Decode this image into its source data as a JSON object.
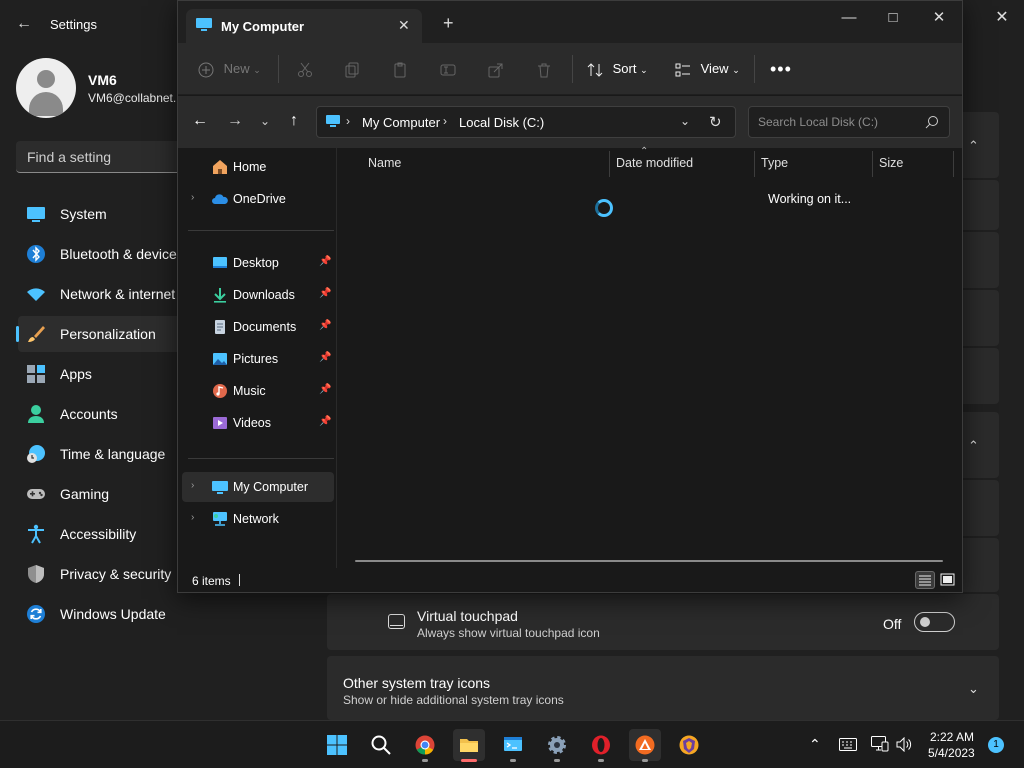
{
  "settings": {
    "title": "Settings",
    "user": {
      "name": "VM6",
      "email": "VM6@collabnet."
    },
    "search_placeholder": "Find a setting",
    "nav": [
      {
        "label": "System",
        "icon": "system-icon"
      },
      {
        "label": "Bluetooth & devices",
        "icon": "bluetooth-icon"
      },
      {
        "label": "Network & internet",
        "icon": "network-icon"
      },
      {
        "label": "Personalization",
        "icon": "brush-icon",
        "selected": true
      },
      {
        "label": "Apps",
        "icon": "apps-icon"
      },
      {
        "label": "Accounts",
        "icon": "accounts-icon"
      },
      {
        "label": "Time & language",
        "icon": "clock-globe-icon"
      },
      {
        "label": "Gaming",
        "icon": "gamepad-icon"
      },
      {
        "label": "Accessibility",
        "icon": "accessibility-icon"
      },
      {
        "label": "Privacy & security",
        "icon": "shield-icon"
      },
      {
        "label": "Windows Update",
        "icon": "update-icon"
      }
    ],
    "virtual_touchpad": {
      "title": "Virtual touchpad",
      "subtitle": "Always show virtual touchpad icon",
      "state": "Off"
    },
    "other_tray": {
      "title": "Other system tray icons",
      "subtitle": "Show or hide additional system tray icons"
    }
  },
  "explorer": {
    "tab_title": "My Computer",
    "toolbar": {
      "new": "New",
      "sort": "Sort",
      "view": "View"
    },
    "breadcrumb": [
      "My Computer",
      "Local Disk (C:)"
    ],
    "search_placeholder": "Search Local Disk (C:)",
    "nav_pane": [
      {
        "label": "Home",
        "icon": "home-icon",
        "expandable": false
      },
      {
        "label": "OneDrive",
        "icon": "onedrive-cloud-icon",
        "expandable": true
      },
      {
        "label": "Desktop",
        "icon": "desktop-folder-icon",
        "pinned": true
      },
      {
        "label": "Downloads",
        "icon": "downloads-icon",
        "pinned": true
      },
      {
        "label": "Documents",
        "icon": "documents-icon",
        "pinned": true
      },
      {
        "label": "Pictures",
        "icon": "pictures-icon",
        "pinned": true
      },
      {
        "label": "Music",
        "icon": "music-icon",
        "pinned": true
      },
      {
        "label": "Videos",
        "icon": "videos-icon",
        "pinned": true
      },
      {
        "label": "My Computer",
        "icon": "computer-icon",
        "expandable": true,
        "selected": true
      },
      {
        "label": "Network",
        "icon": "network-drive-icon",
        "expandable": true
      }
    ],
    "columns": [
      "Name",
      "Date modified",
      "Type",
      "Size"
    ],
    "loading_text": "Working on it...",
    "status_count": "6 items"
  },
  "taskbar": {
    "apps": [
      "start-icon",
      "search-icon",
      "chrome-icon",
      "file-explorer-icon",
      "terminal-icon",
      "settings-gear-icon",
      "opera-icon",
      "app-orange-icon",
      "brave-icon"
    ],
    "time": "2:22 AM",
    "date": "5/4/2023",
    "notifications": "1"
  },
  "colors": {
    "accent": "#4cc2ff",
    "window_bg": "#191919",
    "panel_bg": "#2b2b2b"
  }
}
